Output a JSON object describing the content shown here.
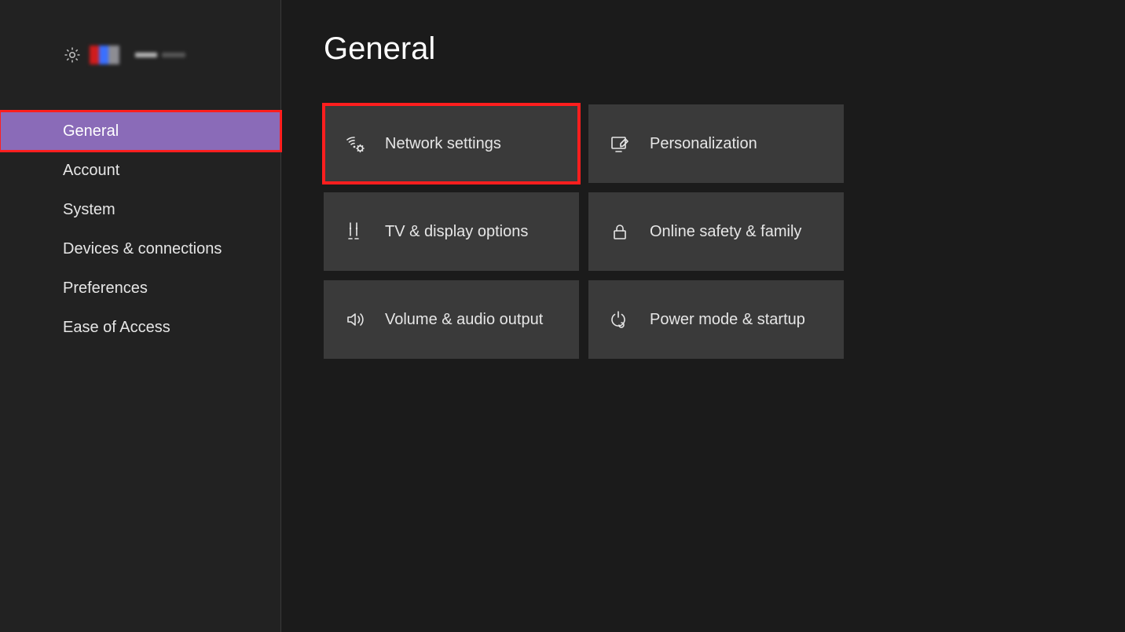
{
  "sidebar": {
    "items": [
      {
        "label": "General",
        "selected": true
      },
      {
        "label": "Account",
        "selected": false
      },
      {
        "label": "System",
        "selected": false
      },
      {
        "label": "Devices & connections",
        "selected": false
      },
      {
        "label": "Preferences",
        "selected": false
      },
      {
        "label": "Ease of Access",
        "selected": false
      }
    ]
  },
  "main": {
    "title": "General",
    "tiles": [
      {
        "id": "network",
        "label": "Network settings",
        "icon": "network-icon",
        "highlight": true
      },
      {
        "id": "personal",
        "label": "Personalization",
        "icon": "personalize-icon",
        "highlight": false
      },
      {
        "id": "tv",
        "label": "TV & display options",
        "icon": "tv-icon",
        "highlight": false
      },
      {
        "id": "safety",
        "label": "Online safety & family",
        "icon": "lock-icon",
        "highlight": false
      },
      {
        "id": "audio",
        "label": "Volume & audio output",
        "icon": "speaker-icon",
        "highlight": false
      },
      {
        "id": "power",
        "label": "Power mode & startup",
        "icon": "power-icon",
        "highlight": false
      }
    ]
  }
}
